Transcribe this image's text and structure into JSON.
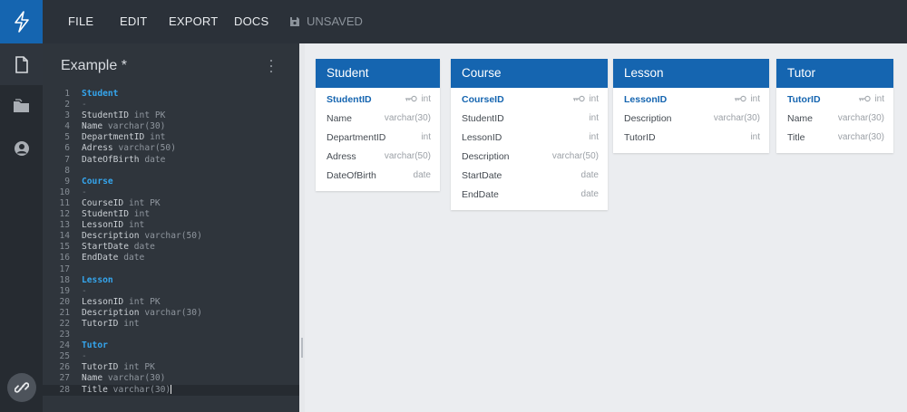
{
  "menu": {
    "file": "FILE",
    "edit": "EDIT",
    "export": "EXPORT",
    "docs": "DOCS",
    "status": "UNSAVED"
  },
  "editor": {
    "title": "Example *",
    "lines": [
      {
        "n": "1",
        "text": "Student",
        "kind": "table"
      },
      {
        "n": "2",
        "text": "-",
        "kind": "dash"
      },
      {
        "n": "3",
        "text": "StudentID",
        "type": "int PK",
        "kind": "field"
      },
      {
        "n": "4",
        "text": "Name",
        "type": "varchar(30)",
        "kind": "field"
      },
      {
        "n": "5",
        "text": "DepartmentID",
        "type": "int",
        "kind": "field"
      },
      {
        "n": "6",
        "text": "Adress",
        "type": "varchar(50)",
        "kind": "field"
      },
      {
        "n": "7",
        "text": "DateOfBirth",
        "type": "date",
        "kind": "field"
      },
      {
        "n": "8",
        "text": "",
        "kind": "blank"
      },
      {
        "n": "9",
        "text": "Course",
        "kind": "table"
      },
      {
        "n": "10",
        "text": "-",
        "kind": "dash"
      },
      {
        "n": "11",
        "text": "CourseID",
        "type": "int PK",
        "kind": "field"
      },
      {
        "n": "12",
        "text": "StudentID",
        "type": "int",
        "kind": "field"
      },
      {
        "n": "13",
        "text": "LessonID",
        "type": "int",
        "kind": "field"
      },
      {
        "n": "14",
        "text": "Description",
        "type": "varchar(50)",
        "kind": "field"
      },
      {
        "n": "15",
        "text": "StartDate",
        "type": "date",
        "kind": "field"
      },
      {
        "n": "16",
        "text": "EndDate",
        "type": "date",
        "kind": "field"
      },
      {
        "n": "17",
        "text": "",
        "kind": "blank"
      },
      {
        "n": "18",
        "text": "Lesson",
        "kind": "table"
      },
      {
        "n": "19",
        "text": "-",
        "kind": "dash"
      },
      {
        "n": "20",
        "text": "LessonID",
        "type": "int PK",
        "kind": "field"
      },
      {
        "n": "21",
        "text": "Description",
        "type": "varchar(30)",
        "kind": "field"
      },
      {
        "n": "22",
        "text": "TutorID",
        "type": "int",
        "kind": "field"
      },
      {
        "n": "23",
        "text": "",
        "kind": "blank"
      },
      {
        "n": "24",
        "text": "Tutor",
        "kind": "table"
      },
      {
        "n": "25",
        "text": "-",
        "kind": "dash"
      },
      {
        "n": "26",
        "text": "TutorID",
        "type": "int PK",
        "kind": "field"
      },
      {
        "n": "27",
        "text": "Name",
        "type": "varchar(30)",
        "kind": "field"
      },
      {
        "n": "28",
        "text": "Title",
        "type": "varchar(30)",
        "kind": "cursor"
      }
    ]
  },
  "tables": [
    {
      "name": "Student",
      "fields": [
        {
          "name": "StudentID",
          "type": "int",
          "pk": true
        },
        {
          "name": "Name",
          "type": "varchar(30)"
        },
        {
          "name": "DepartmentID",
          "type": "int"
        },
        {
          "name": "Adress",
          "type": "varchar(50)"
        },
        {
          "name": "DateOfBirth",
          "type": "date"
        }
      ]
    },
    {
      "name": "Course",
      "fields": [
        {
          "name": "CourseID",
          "type": "int",
          "pk": true
        },
        {
          "name": "StudentID",
          "type": "int"
        },
        {
          "name": "LessonID",
          "type": "int"
        },
        {
          "name": "Description",
          "type": "varchar(50)"
        },
        {
          "name": "StartDate",
          "type": "date"
        },
        {
          "name": "EndDate",
          "type": "date"
        }
      ]
    },
    {
      "name": "Lesson",
      "fields": [
        {
          "name": "LessonID",
          "type": "int",
          "pk": true
        },
        {
          "name": "Description",
          "type": "varchar(30)"
        },
        {
          "name": "TutorID",
          "type": "int"
        }
      ]
    },
    {
      "name": "Tutor",
      "fields": [
        {
          "name": "TutorID",
          "type": "int",
          "pk": true
        },
        {
          "name": "Name",
          "type": "varchar(30)"
        },
        {
          "name": "Title",
          "type": "varchar(30)"
        }
      ]
    }
  ],
  "colors": {
    "accent": "#1565b0",
    "editor_bg": "#2f353c",
    "canvas_bg": "#ebedf0",
    "keyword": "#35a6ee"
  },
  "icons": [
    "lightning-logo-icon",
    "document-icon",
    "folder-icon",
    "user-account-icon",
    "link-icon",
    "save-disk-icon",
    "more-vertical-icon",
    "key-icon"
  ]
}
